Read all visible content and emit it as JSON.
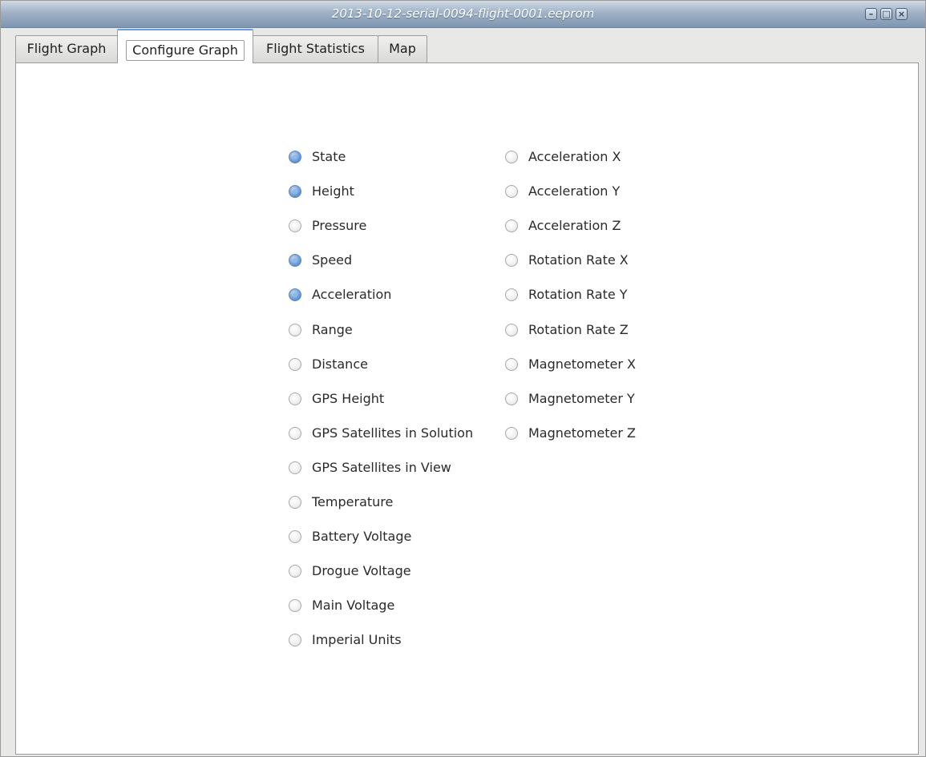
{
  "window": {
    "title": "2013-10-12-serial-0094-flight-0001.eeprom",
    "buttons": {
      "minimize": "–",
      "maximize": "□",
      "close": "×"
    }
  },
  "tabs": [
    {
      "label": "Flight Graph",
      "active": false
    },
    {
      "label": "Configure Graph",
      "active": true
    },
    {
      "label": "Flight Statistics",
      "active": false
    },
    {
      "label": "Map",
      "active": false
    }
  ],
  "options": {
    "left": [
      {
        "label": "State",
        "checked": true
      },
      {
        "label": "Height",
        "checked": true
      },
      {
        "label": "Pressure",
        "checked": false
      },
      {
        "label": "Speed",
        "checked": true
      },
      {
        "label": "Acceleration",
        "checked": true
      },
      {
        "label": "Range",
        "checked": false
      },
      {
        "label": "Distance",
        "checked": false
      },
      {
        "label": "GPS Height",
        "checked": false
      },
      {
        "label": "GPS Satellites in Solution",
        "checked": false
      },
      {
        "label": "GPS Satellites in View",
        "checked": false
      },
      {
        "label": "Temperature",
        "checked": false
      },
      {
        "label": "Battery Voltage",
        "checked": false
      },
      {
        "label": "Drogue Voltage",
        "checked": false
      },
      {
        "label": "Main Voltage",
        "checked": false
      },
      {
        "label": "Imperial Units",
        "checked": false
      }
    ],
    "right": [
      {
        "label": "Acceleration X",
        "checked": false
      },
      {
        "label": "Acceleration Y",
        "checked": false
      },
      {
        "label": "Acceleration Z",
        "checked": false
      },
      {
        "label": "Rotation Rate X",
        "checked": false
      },
      {
        "label": "Rotation Rate Y",
        "checked": false
      },
      {
        "label": "Rotation Rate Z",
        "checked": false
      },
      {
        "label": "Magnetometer X",
        "checked": false
      },
      {
        "label": "Magnetometer Y",
        "checked": false
      },
      {
        "label": "Magnetometer Z",
        "checked": false
      }
    ]
  },
  "colors": {
    "accent": "#6b9fd8",
    "radio_checked": "#3f74b8",
    "titlebar": "#9fb1c6"
  }
}
